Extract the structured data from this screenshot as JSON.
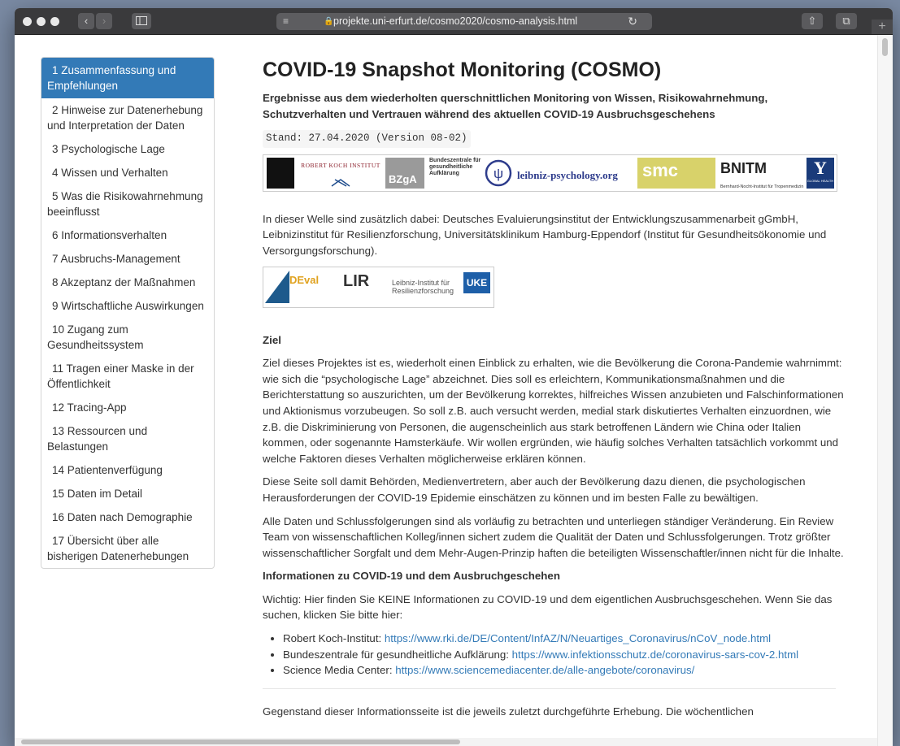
{
  "browser": {
    "url": "projekte.uni-erfurt.de/cosmo2020/cosmo-analysis.html",
    "lock_icon": "lock-icon",
    "reader_icon": "reader-icon",
    "reload_icon": "reload-icon"
  },
  "toc": {
    "items": [
      {
        "label": "1 Zusammenfassung und Empfehlungen"
      },
      {
        "label": "2 Hinweise zur Datenerhebung und Interpretation der Daten"
      },
      {
        "label": "3 Psychologische Lage"
      },
      {
        "label": "4 Wissen und Verhalten"
      },
      {
        "label": "5 Was die Risikowahrnehmung beeinflusst"
      },
      {
        "label": "6 Informationsverhalten"
      },
      {
        "label": "7 Ausbruchs-Management"
      },
      {
        "label": "8 Akzeptanz der Maßnahmen"
      },
      {
        "label": "9 Wirtschaftliche Auswirkungen"
      },
      {
        "label": "10 Zugang zum Gesundheitssystem"
      },
      {
        "label": "11 Tragen einer Maske in der Öffentlichkeit"
      },
      {
        "label": "12 Tracing-App"
      },
      {
        "label": "13 Ressourcen und Belastungen"
      },
      {
        "label": "14 Patientenverfügung"
      },
      {
        "label": "15 Daten im Detail"
      },
      {
        "label": "16 Daten nach Demographie"
      },
      {
        "label": "17 Übersicht über alle bisherigen Datenerhebungen"
      }
    ],
    "active_color": "#337ab7"
  },
  "main": {
    "title": "COVID-19 Snapshot Monitoring (COSMO)",
    "subtitle": "Ergebnisse aus dem wiederholten querschnittlichen Monitoring von Wissen, Risikowahrnehmung, Schutzverhalten und Vertrauen während des aktuellen COVID-19 Ausbruchsgeschehens",
    "stand": "Stand: 27.04.2020 (Version 08-02)",
    "logos1": {
      "rki": "ROBERT KOCH INSTITUT",
      "bzga_big": "BZgA",
      "bzga_text": "Bundeszentrale für gesundheitliche Aufklärung",
      "lp": "leibniz-psychology.org",
      "smc": "smc",
      "bnitm": "BNITM",
      "bnitm_sub": "Bernhard-Nocht-Institut für Tropenmedizin",
      "yale": "Y",
      "yale_sub": "GLOBAL HEALTH"
    },
    "intro": "In dieser Welle sind zusätzlich dabei: Deutsches Evaluierungsinstitut der Entwicklungszusammenarbeit gGmbH, Leibnizinstitut für Resilienzforschung, Universitätsklinikum Hamburg-Eppendorf (Institut für Gesundheitsökonomie und Versorgungsforschung).",
    "logos2": {
      "deval": "DEval",
      "lir": "LIR",
      "lir_text": "Leibniz-Institut für Resilienzforschung",
      "uke": "UKE"
    },
    "ziel_heading": "Ziel",
    "ziel_p1": "Ziel dieses Projektes ist es, wiederholt einen Einblick zu erhalten, wie die Bevölkerung die Corona-Pandemie wahrnimmt: wie sich die “psychologische Lage” abzeichnet. Dies soll es erleichtern, Kommunikationsmaßnahmen und die Berichterstattung so auszurichten, um der Bevölkerung korrektes, hilfreiches Wissen anzubieten und Falschinformationen und Aktionismus vorzubeugen. So soll z.B. auch versucht werden, medial stark diskutiertes Verhalten einzuordnen, wie z.B. die Diskriminierung von Personen, die augenscheinlich aus stark betroffenen Ländern wie China oder Italien kommen, oder sogenannte Hamsterkäufe. Wir wollen ergründen, wie häufig solches Verhalten tatsächlich vorkommt und welche Faktoren dieses Verhalten möglicherweise erklären können.",
    "ziel_p2": "Diese Seite soll damit Behörden, Medienvertretern, aber auch der Bevölkerung dazu dienen, die psychologischen Herausforderungen der COVID-19 Epidemie einschätzen zu können und im besten Falle zu bewältigen.",
    "ziel_p3": "Alle Daten und Schlussfolgerungen sind als vorläufig zu betrachten und unterliegen ständiger Veränderung. Ein Review Team von wissenschaftlichen Kolleg/innen sichert zudem die Qualität der Daten und Schlussfolgerungen. Trotz größter wissenschaftlicher Sorgfalt und dem Mehr-Augen-Prinzip haften die beteiligten Wissenschaftler/innen nicht für die Inhalte.",
    "info_heading": "Informationen zu COVID-19 und dem Ausbruchgeschehen",
    "info_p": "Wichtig: Hier finden Sie KEINE Informationen zu COVID-19 und dem eigentlichen Ausbruchsgeschehen. Wenn Sie das suchen, klicken Sie bitte hier:",
    "links": [
      {
        "label": "Robert Koch-Institut: ",
        "url": "https://www.rki.de/DE/Content/InfAZ/N/Neuartiges_Coronavirus/nCoV_node.html"
      },
      {
        "label": "Bundeszentrale für gesundheitliche Aufklärung: ",
        "url": "https://www.infektionsschutz.de/coronavirus-sars-cov-2.html"
      },
      {
        "label": "Science Media Center: ",
        "url": "https://www.sciencemediacenter.de/alle-angebote/coronavirus/"
      }
    ],
    "gegenstand": "Gegenstand dieser Informationsseite ist die jeweils zuletzt durchgeführte Erhebung. Die wöchentlichen"
  }
}
